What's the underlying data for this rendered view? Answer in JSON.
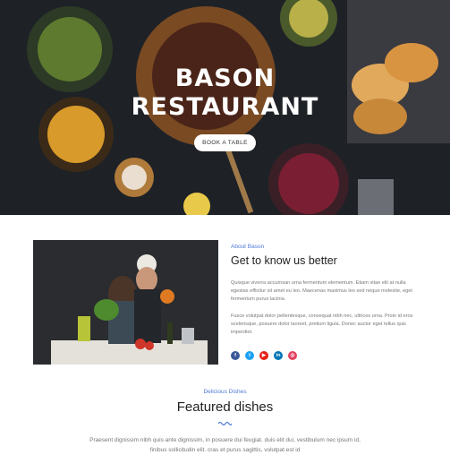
{
  "hero": {
    "title_line1": "BASON",
    "title_line2": "RESTAURANT",
    "cta_label": "BOOK A TABLE"
  },
  "about": {
    "eyebrow": "About Bason",
    "title": "Get to know us better",
    "paragraph1": "Quisque viverra accumsan urna fermentum elementum. Etiam vitae elit at nulla egestas efficitur sit amet eu leo. Maecenas maximus leo sed neque molestie, eget fermentum purus lacinia.",
    "paragraph2": "Fusce volutpat dolor pellentesque, consequat nibh nec, ultrices urna. Proin id eros scelerisque, posuere dolor laoreet, pretium ligula. Donec auctor eget tellus quis imperdiet.",
    "social": [
      {
        "icon": "facebook-icon",
        "glyph": "f",
        "color": "#3b5998"
      },
      {
        "icon": "twitter-icon",
        "glyph": "t",
        "color": "#1da1f2"
      },
      {
        "icon": "youtube-icon",
        "glyph": "▶",
        "color": "#e62117"
      },
      {
        "icon": "linkedin-icon",
        "glyph": "in",
        "color": "#0077b5"
      },
      {
        "icon": "instagram-icon",
        "glyph": "◎",
        "color": "#e4405f"
      }
    ]
  },
  "featured": {
    "eyebrow": "Delicious Dishes",
    "title": "Featured dishes",
    "text": "Praesent dignissim nibh quis ante dignissim, in posuere dui feugiat. duis elit dui, vestibulum nec ipsum id, finibus sollicitudin elit. cras et purus sagittis, volutpat est id"
  },
  "colors": {
    "accent": "#4e7bd6",
    "hero_bg": "#1b1f24"
  }
}
